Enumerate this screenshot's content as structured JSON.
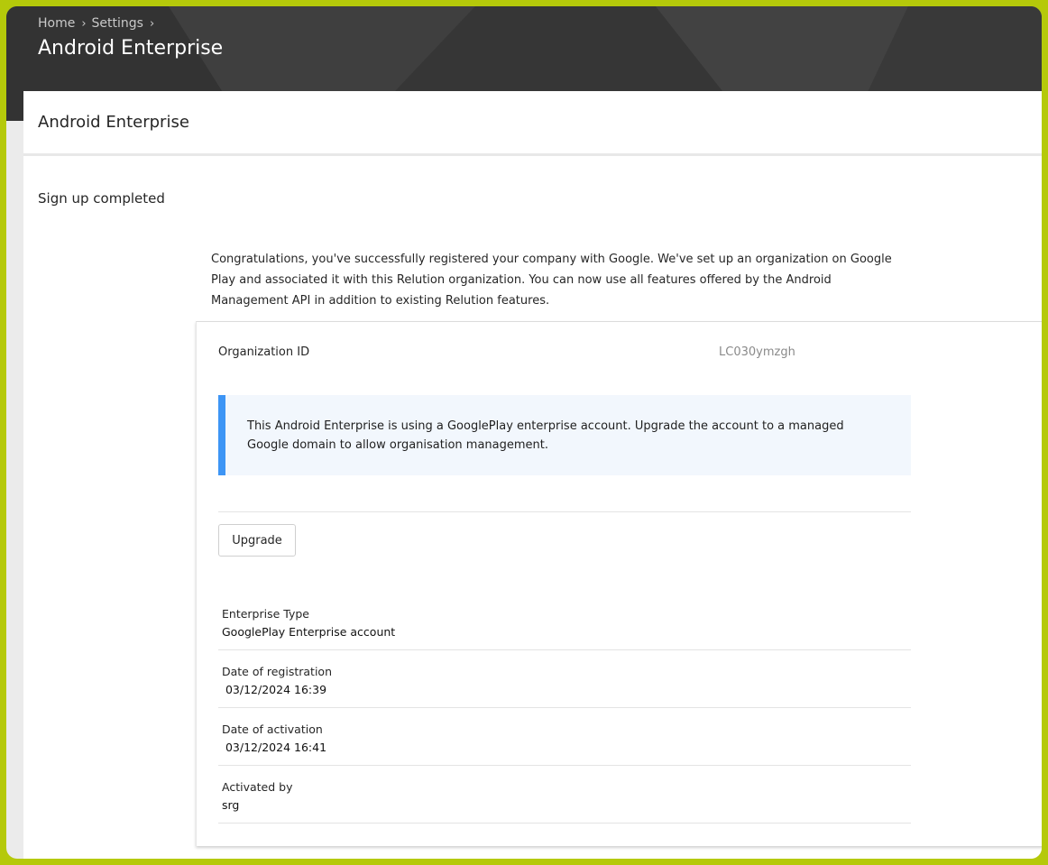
{
  "header": {
    "breadcrumb": [
      {
        "label": "Home"
      },
      {
        "label": "Settings"
      }
    ],
    "title": "Android Enterprise"
  },
  "panel": {
    "title": "Android Enterprise",
    "section_label": "Sign up completed",
    "intro": "Congratulations, you've successfully registered your company with Google. We've set up an organization on Google Play and associated it with this Relution organization. You can now use all features offered by the Android Management API in addition to existing Relution features."
  },
  "card": {
    "org_label": "Organization ID",
    "org_value": "LC030ymzgh",
    "notice": "This Android Enterprise is using a GooglePlay enterprise account. Upgrade the account to a managed Google domain to allow organisation management.",
    "upgrade_label": "Upgrade",
    "details": [
      {
        "label": "Enterprise Type",
        "value": "GooglePlay Enterprise account"
      },
      {
        "label": "Date of registration",
        "value": " 03/12/2024 16:39"
      },
      {
        "label": "Date of activation",
        "value": " 03/12/2024 16:41"
      },
      {
        "label": "Activated by",
        "value": "srg"
      }
    ]
  },
  "colors": {
    "frame_accent": "#b5c90a",
    "header_bg": "#3b3b3b",
    "notice_accent": "#3d95f5",
    "notice_bg": "#f2f7fd"
  },
  "icons": {
    "breadcrumb_separator": "chevron-right-icon"
  }
}
